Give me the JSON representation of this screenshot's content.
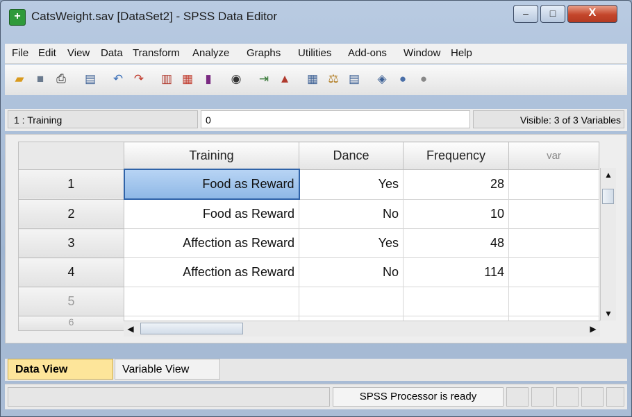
{
  "window": {
    "title": "CatsWeight.sav [DataSet2] - SPSS Data Editor",
    "minimize_glyph": "–",
    "maximize_glyph": "□",
    "close_glyph": "X"
  },
  "menu": [
    "File",
    "Edit",
    "View",
    "Data",
    "Transform",
    "Analyze",
    "Graphs",
    "Utilities",
    "Add-ons",
    "Window",
    "Help"
  ],
  "toolbar_icons": [
    "open-folder-icon",
    "save-icon",
    "print-icon",
    "dialog-recall-icon",
    "undo-icon",
    "redo-icon",
    "goto-case-icon",
    "goto-variable-icon",
    "variables-icon",
    "find-icon",
    "insert-cases-icon",
    "insert-variable-icon",
    "split-file-icon",
    "weight-cases-icon",
    "select-cases-icon",
    "value-labels-icon",
    "use-sets-icon",
    "show-all-variables-icon"
  ],
  "cellbar": {
    "cell_ref": "1 : Training",
    "cell_value": "0",
    "visible_vars": "Visible: 3 of 3 Variables"
  },
  "grid": {
    "columns": [
      "Training",
      "Dance",
      "Frequency",
      "var"
    ],
    "rows": [
      {
        "num": "1",
        "training": "Food as Reward",
        "dance": "Yes",
        "frequency": "28"
      },
      {
        "num": "2",
        "training": "Food as Reward",
        "dance": "No",
        "frequency": "10"
      },
      {
        "num": "3",
        "training": "Affection as Reward",
        "dance": "Yes",
        "frequency": "48"
      },
      {
        "num": "4",
        "training": "Affection as Reward",
        "dance": "No",
        "frequency": "114"
      },
      {
        "num": "5",
        "training": "",
        "dance": "",
        "frequency": ""
      },
      {
        "num": "6",
        "training": "",
        "dance": "",
        "frequency": ""
      }
    ],
    "selected_cell": "row 1, Training"
  },
  "tabs": {
    "data_view": "Data View",
    "variable_view": "Variable View"
  },
  "status": {
    "processor": "SPSS  Processor is ready"
  }
}
